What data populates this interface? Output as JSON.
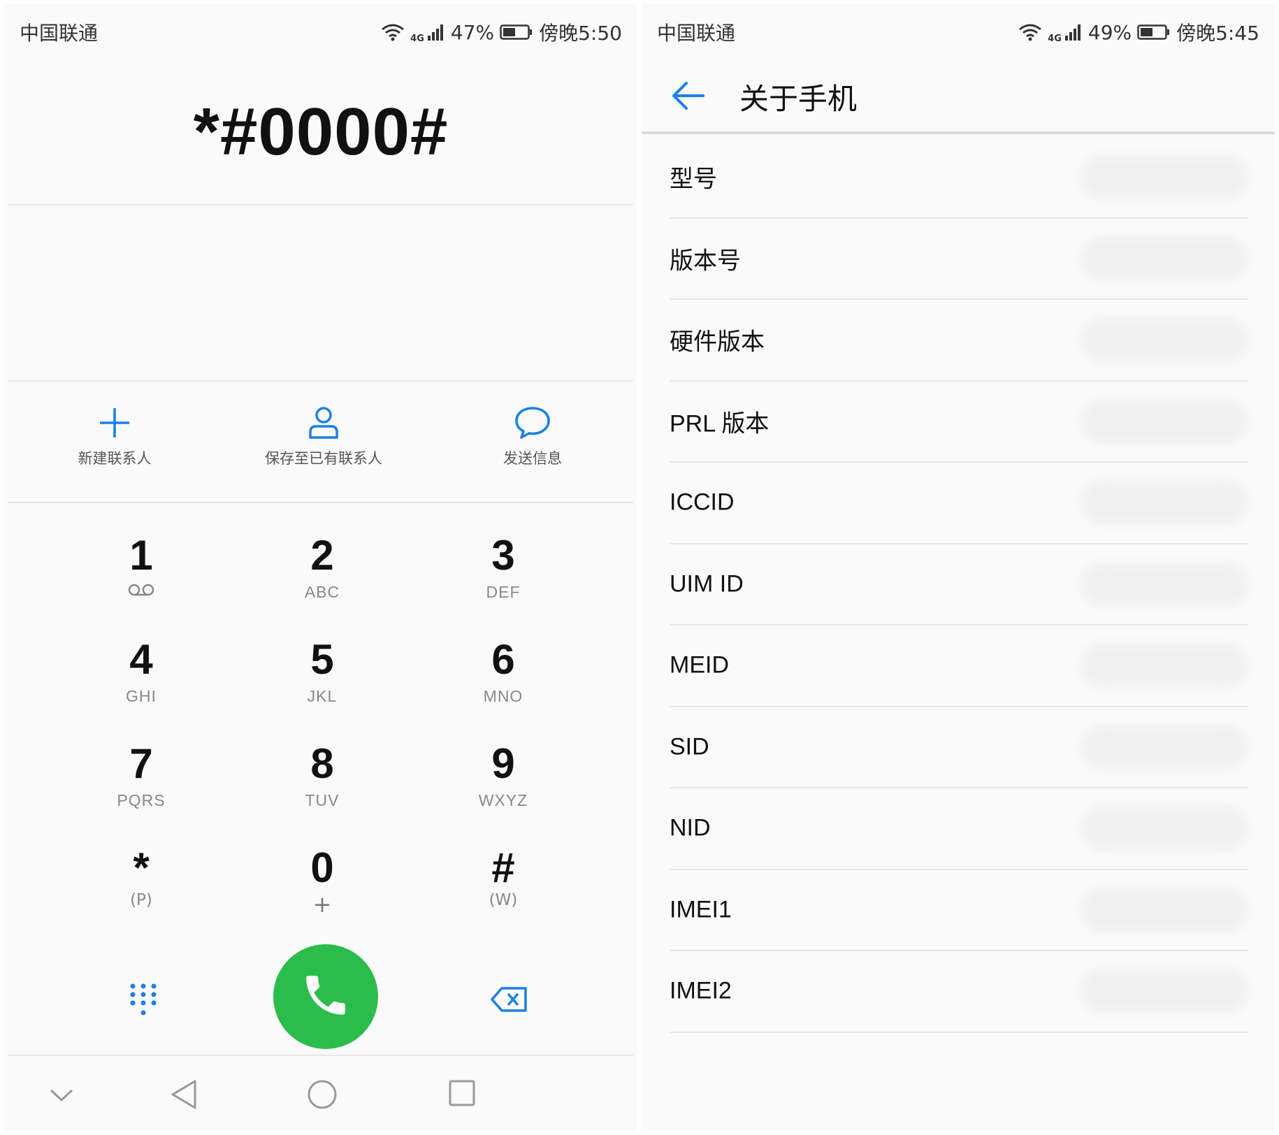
{
  "left_screen": {
    "status_bar": {
      "carrier": "中国联通",
      "network": "4G",
      "battery": "47%",
      "time": "傍晚5:50"
    },
    "dial_input": "*#0000#",
    "actions": [
      {
        "label": "新建联系人",
        "icon": "plus-icon"
      },
      {
        "label": "保存至已有联系人",
        "icon": "person-icon"
      },
      {
        "label": "发送信息",
        "icon": "message-bubble-icon"
      }
    ],
    "keypad": [
      {
        "digit": "1",
        "letters": "",
        "sub": ""
      },
      {
        "digit": "2",
        "letters": "ABC",
        "sub": ""
      },
      {
        "digit": "3",
        "letters": "DEF",
        "sub": ""
      },
      {
        "digit": "4",
        "letters": "GHI",
        "sub": ""
      },
      {
        "digit": "5",
        "letters": "JKL",
        "sub": ""
      },
      {
        "digit": "6",
        "letters": "MNO",
        "sub": ""
      },
      {
        "digit": "7",
        "letters": "PQRS",
        "sub": ""
      },
      {
        "digit": "8",
        "letters": "TUV",
        "sub": ""
      },
      {
        "digit": "9",
        "letters": "WXYZ",
        "sub": ""
      },
      {
        "digit": "*",
        "letters": "",
        "sub": "(P)"
      },
      {
        "digit": "0",
        "letters": "",
        "sub": "+"
      },
      {
        "digit": "#",
        "letters": "",
        "sub": "(W)"
      }
    ],
    "colors": {
      "accent": "#1a7fe8",
      "call": "#2bbd4b"
    }
  },
  "right_screen": {
    "status_bar": {
      "carrier": "中国联通",
      "network": "4G",
      "battery": "49%",
      "time": "傍晚5:45"
    },
    "title": "关于手机",
    "items": [
      "型号",
      "版本号",
      "硬件版本",
      "PRL 版本",
      "ICCID",
      "UIM ID",
      "MEID",
      "SID",
      "NID",
      "IMEI1",
      "IMEI2"
    ]
  }
}
